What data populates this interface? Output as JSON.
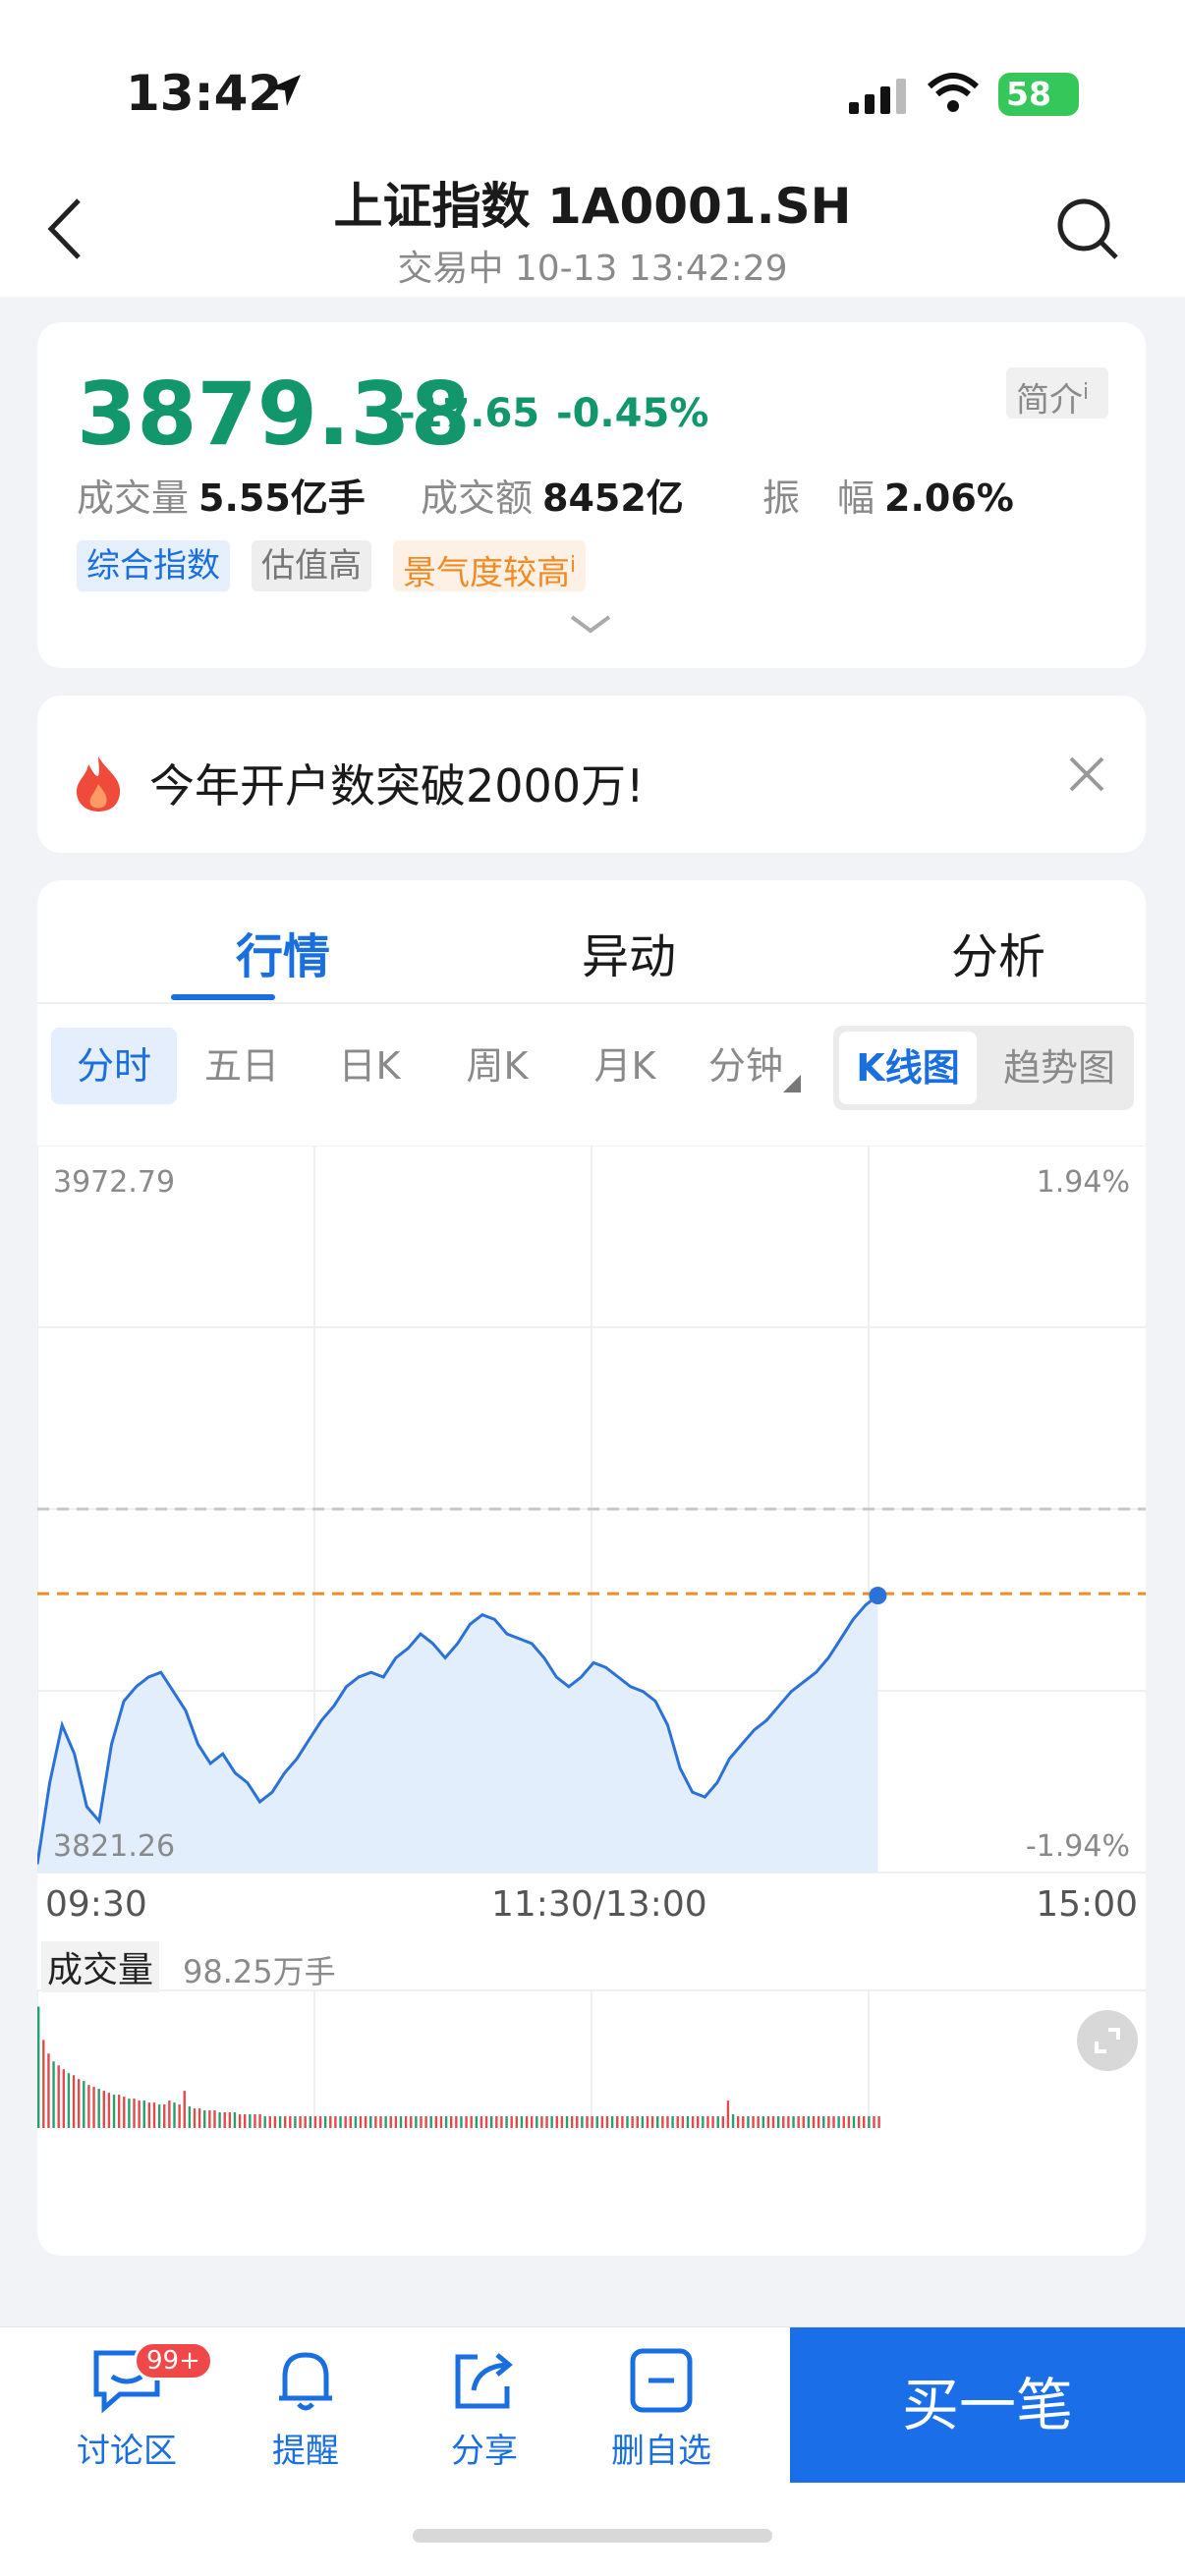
{
  "status": {
    "time": "13:42",
    "battery": "58"
  },
  "header": {
    "title": "上证指数 1A0001.SH",
    "subtitle": "交易中 10-13 13:42:29"
  },
  "quote": {
    "price": "3879.38",
    "change": "-17.65",
    "change_pct": "-0.45%",
    "intro_label": "简介",
    "volume_label": "成交量",
    "volume_value": "5.55亿手",
    "amount_label": "成交额",
    "amount_value": "8452亿",
    "amplitude_label": "振　幅",
    "amplitude_value": "2.06%",
    "tags": [
      "综合指数",
      "估值高",
      "景气度较高"
    ],
    "colors": {
      "down": "#12966b",
      "up": "#e24b4b",
      "accent": "#1a6fe0"
    }
  },
  "banner": {
    "text": "今年开户数突破2000万!"
  },
  "tabs": [
    "行情",
    "异动",
    "分析"
  ],
  "periods": [
    "分时",
    "五日",
    "日K",
    "周K",
    "月K",
    "分钟"
  ],
  "chart_toggle": [
    "K线图",
    "趋势图"
  ],
  "chart_labels": {
    "y_max": "3972.79",
    "y_min": "3821.26",
    "pct_max": "1.94%",
    "pct_min": "-1.94%",
    "t_start": "09:30",
    "t_mid": "11:30/13:00",
    "t_end": "15:00",
    "vol_label": "成交量",
    "vol_value": "98.25万手"
  },
  "chart_data": {
    "type": "area",
    "ylim": [
      3821.26,
      3972.79
    ],
    "prev_close": 3897.03,
    "current": 3879.38,
    "x_range": [
      "09:30",
      "15:00"
    ],
    "values": [
      3823,
      3840,
      3852,
      3846,
      3835,
      3832,
      3848,
      3857,
      3860,
      3862,
      3863,
      3859,
      3855,
      3848,
      3844,
      3846,
      3842,
      3840,
      3836,
      3838,
      3842,
      3845,
      3849,
      3853,
      3856,
      3860,
      3862,
      3863,
      3862,
      3866,
      3868,
      3871,
      3869,
      3866,
      3869,
      3873,
      3875,
      3874,
      3871,
      3870,
      3869,
      3866,
      3862,
      3860,
      3862,
      3865,
      3864,
      3862,
      3860,
      3859,
      3857,
      3852,
      3843,
      3838,
      3837,
      3840,
      3845,
      3848,
      3851,
      3853,
      3856,
      3859,
      3861,
      3863,
      3866,
      3870,
      3874,
      3877,
      3879
    ],
    "volume_levels": [
      0.62,
      0.45,
      0.38,
      0.34,
      0.32,
      0.3,
      0.28,
      0.27,
      0.25,
      0.24,
      0.22,
      0.21,
      0.2,
      0.19,
      0.18,
      0.17,
      0.17,
      0.16,
      0.15,
      0.15,
      0.14,
      0.14,
      0.13,
      0.13,
      0.12,
      0.12,
      0.14,
      0.13,
      0.12,
      0.19,
      0.11,
      0.1,
      0.1,
      0.09,
      0.09,
      0.09,
      0.08,
      0.08,
      0.08,
      0.08,
      0.07,
      0.07,
      0.07,
      0.07,
      0.07,
      0.06,
      0.06,
      0.06,
      0.06,
      0.06,
      0.06,
      0.06,
      0.06,
      0.06,
      0.06,
      0.06,
      0.06,
      0.06,
      0.06,
      0.06,
      0.06,
      0.06,
      0.06,
      0.06,
      0.06,
      0.06,
      0.06,
      0.06,
      0.06,
      0.06,
      0.06,
      0.06,
      0.06,
      0.06,
      0.06,
      0.06,
      0.06,
      0.06,
      0.06,
      0.06,
      0.06,
      0.06,
      0.06,
      0.06,
      0.06,
      0.06,
      0.06,
      0.06,
      0.06,
      0.06,
      0.06,
      0.06,
      0.06,
      0.06,
      0.06,
      0.06,
      0.06,
      0.06,
      0.06,
      0.06,
      0.06,
      0.06,
      0.06,
      0.06,
      0.06,
      0.06,
      0.06,
      0.06,
      0.06,
      0.06,
      0.06,
      0.06,
      0.06,
      0.06,
      0.06,
      0.06,
      0.06,
      0.06,
      0.06,
      0.06,
      0.06,
      0.06,
      0.06,
      0.06,
      0.06,
      0.06,
      0.06,
      0.06,
      0.06,
      0.06,
      0.06,
      0.06,
      0.06,
      0.06,
      0.06,
      0.06,
      0.06,
      0.14,
      0.07,
      0.06,
      0.06,
      0.06,
      0.06,
      0.06,
      0.06,
      0.06,
      0.06,
      0.06,
      0.06,
      0.06,
      0.06,
      0.06,
      0.06,
      0.06,
      0.06,
      0.06,
      0.06,
      0.06,
      0.06,
      0.06,
      0.06,
      0.06,
      0.06,
      0.06,
      0.06,
      0.06,
      0.06,
      0.06
    ]
  },
  "bottom_nav": [
    {
      "label": "讨论区",
      "badge": "99+"
    },
    {
      "label": "提醒"
    },
    {
      "label": "分享"
    },
    {
      "label": "删自选"
    }
  ],
  "buy_label": "买一笔"
}
